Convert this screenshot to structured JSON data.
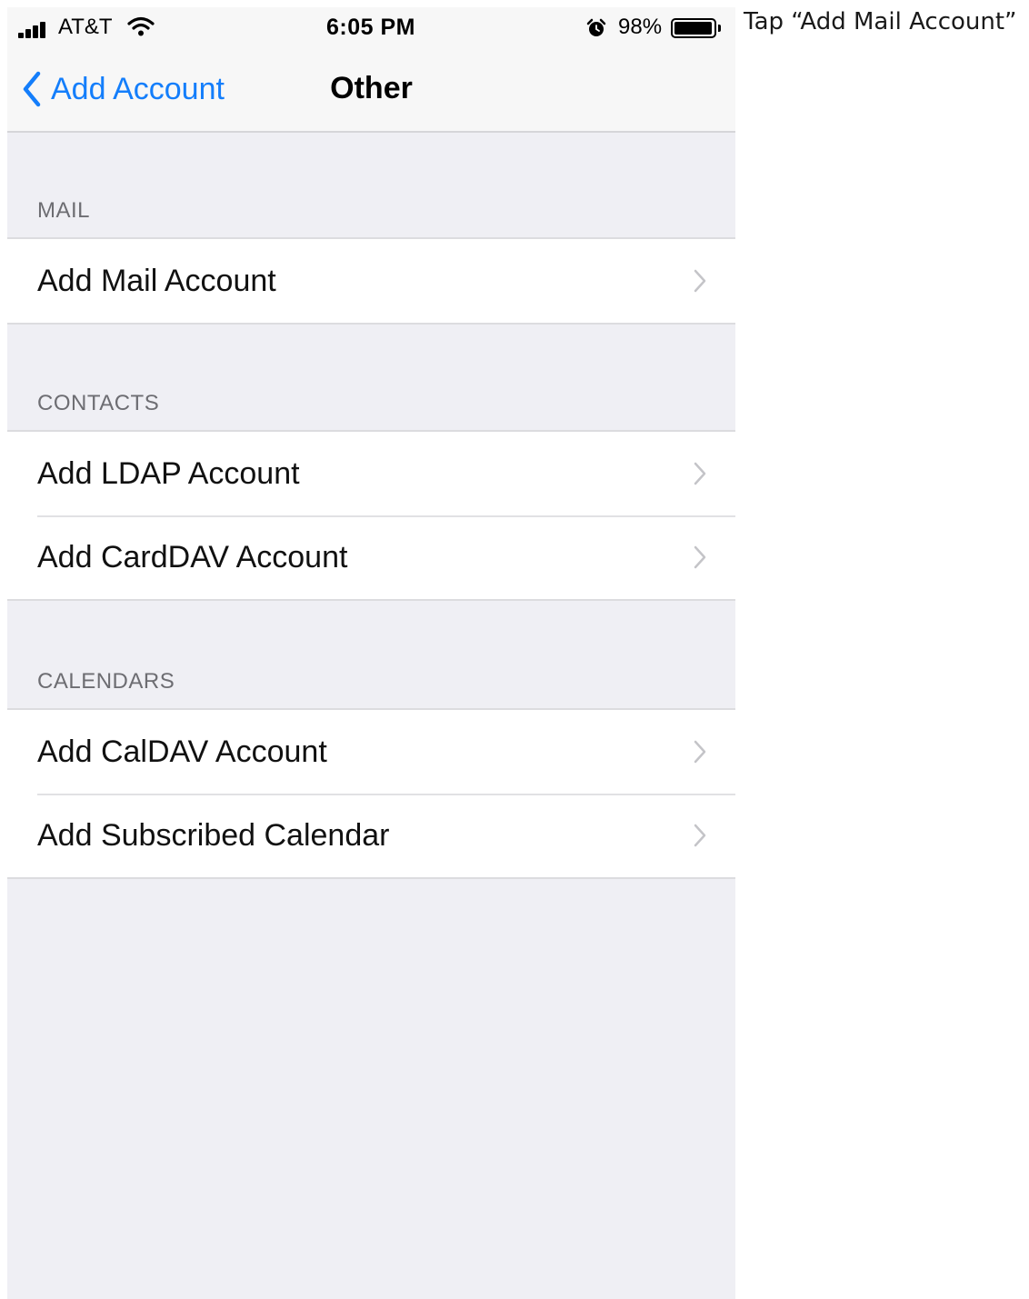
{
  "status_bar": {
    "carrier": "AT&T",
    "time": "6:05 PM",
    "battery_percent": "98%",
    "signal_icon": "signal-bars-icon",
    "wifi_icon": "wifi-icon",
    "alarm_icon": "alarm-clock-icon",
    "battery_icon": "battery-icon",
    "battery_level": 0.98
  },
  "nav": {
    "back_label": "Add Account",
    "back_icon": "chevron-left-icon",
    "title": "Other",
    "accent_color": "#147efb"
  },
  "sections": [
    {
      "header": "MAIL",
      "items": [
        {
          "label": "Add Mail Account"
        }
      ]
    },
    {
      "header": "CONTACTS",
      "items": [
        {
          "label": "Add LDAP Account"
        },
        {
          "label": "Add CardDAV Account"
        }
      ]
    },
    {
      "header": "CALENDARS",
      "items": [
        {
          "label": "Add CalDAV Account"
        },
        {
          "label": "Add Subscribed Calendar"
        }
      ]
    }
  ],
  "row_icon": "chevron-right-icon",
  "caption": "Tap “Add Mail Account”"
}
